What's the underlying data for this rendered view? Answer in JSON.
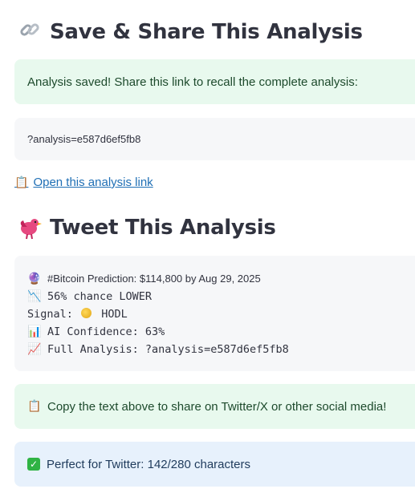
{
  "save_section": {
    "icon": "link-icon",
    "title": "Save & Share This Analysis",
    "success_message": "Analysis saved! Share this link to recall the complete analysis:",
    "link_code": "?analysis=e587d6ef5fb8",
    "open_link_icon": "clipboard-icon",
    "open_link_label": "Open this analysis link"
  },
  "tweet_section": {
    "icon": "bird-icon",
    "title": "Tweet This Analysis",
    "tweet_lines": [
      {
        "icon": "crystal-ball-icon",
        "text": "#Bitcoin Prediction: $114,800 by Aug 29, 2025"
      },
      {
        "icon": "chart-down-icon",
        "text": "56% chance LOWER"
      },
      {
        "icon": "coin-icon",
        "prefix": "Signal:",
        "text": "HODL"
      },
      {
        "icon": "bar-chart-icon",
        "text": "AI Confidence: 63%"
      },
      {
        "icon": "chart-up-icon",
        "text": "Full Analysis: ?analysis=e587d6ef5fb8"
      }
    ],
    "copy_message": "Copy the text above to share on Twitter/X or other social media!",
    "copy_icon": "clipboard-icon",
    "chars_icon": "check-icon",
    "chars_message": "Perfect for Twitter: 142/280 characters"
  },
  "colors": {
    "success_bg": "#e8f9ee",
    "info_bg": "#e7f1fc",
    "code_bg": "#f6f7f9",
    "link": "#1f6fb5"
  }
}
